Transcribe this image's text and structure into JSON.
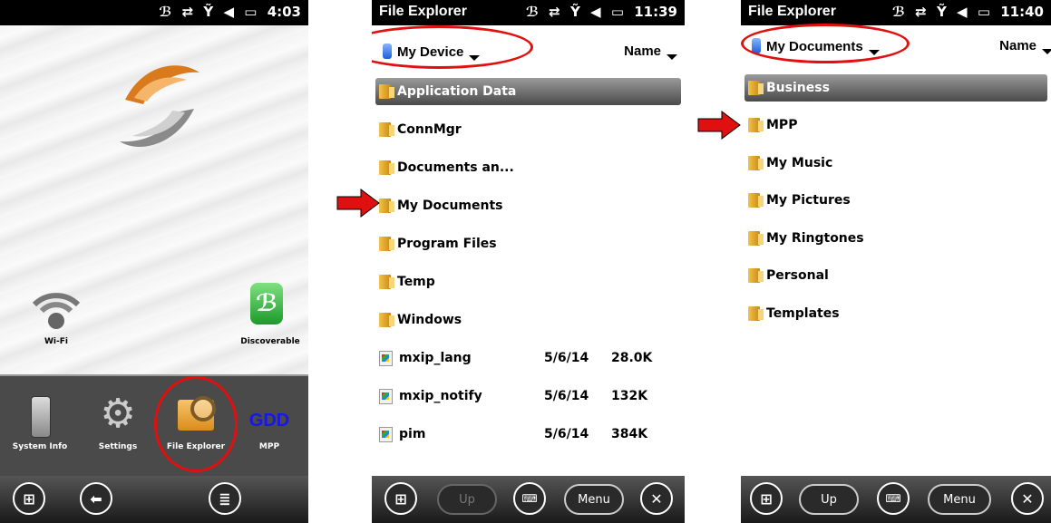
{
  "colors": {
    "highlight_circle": "#e01010",
    "arrow": "#e01010",
    "gdd_text": "#1717e8",
    "launcher_bg": "#4a4a4a"
  },
  "screen1": {
    "status": {
      "icons": [
        "bluetooth-icon",
        "sync-icon",
        "no-signal-icon",
        "volume-icon",
        "battery-icon"
      ],
      "time": "4:03"
    },
    "home_items": [
      {
        "label": "Wi-Fi",
        "icon": "wifi-icon"
      },
      {
        "label": "Discoverable",
        "icon": "bluetooth-icon"
      }
    ],
    "launcher": [
      {
        "label": "System Info",
        "icon": "device-icon"
      },
      {
        "label": "Settings",
        "icon": "gear-icon"
      },
      {
        "label": "File Explorer",
        "icon": "file-explorer-icon"
      },
      {
        "label": "MPP",
        "icon_text": "GDD"
      }
    ],
    "bottom": [
      "windows-start-icon",
      "back-icon",
      "menu-list-icon"
    ]
  },
  "screen2": {
    "title": "File Explorer",
    "time": "11:39",
    "location": "My Device",
    "sort": "Name",
    "rows": [
      {
        "name": "Application Data",
        "type": "folder",
        "selected": true
      },
      {
        "name": "ConnMgr",
        "type": "folder"
      },
      {
        "name": "Documents an...",
        "type": "folder"
      },
      {
        "name": "My Documents",
        "type": "folder"
      },
      {
        "name": "Program Files",
        "type": "folder"
      },
      {
        "name": "Temp",
        "type": "folder"
      },
      {
        "name": "Windows",
        "type": "folder"
      },
      {
        "name": "mxip_lang",
        "type": "file",
        "date": "5/6/14",
        "size": "28.0K"
      },
      {
        "name": "mxip_notify",
        "type": "file",
        "date": "5/6/14",
        "size": "132K"
      },
      {
        "name": "pim",
        "type": "file",
        "date": "5/6/14",
        "size": "384K"
      }
    ],
    "buttons": {
      "up": "Up",
      "menu": "Menu"
    }
  },
  "screen3": {
    "title": "File Explorer",
    "time": "11:40",
    "location": "My Documents",
    "sort": "Name",
    "rows": [
      {
        "name": "Business",
        "type": "folder",
        "selected": true
      },
      {
        "name": "MPP",
        "type": "folder"
      },
      {
        "name": "My Music",
        "type": "folder"
      },
      {
        "name": "My Pictures",
        "type": "folder"
      },
      {
        "name": "My Ringtones",
        "type": "folder"
      },
      {
        "name": "Personal",
        "type": "folder"
      },
      {
        "name": "Templates",
        "type": "folder"
      }
    ],
    "buttons": {
      "up": "Up",
      "menu": "Menu"
    }
  }
}
